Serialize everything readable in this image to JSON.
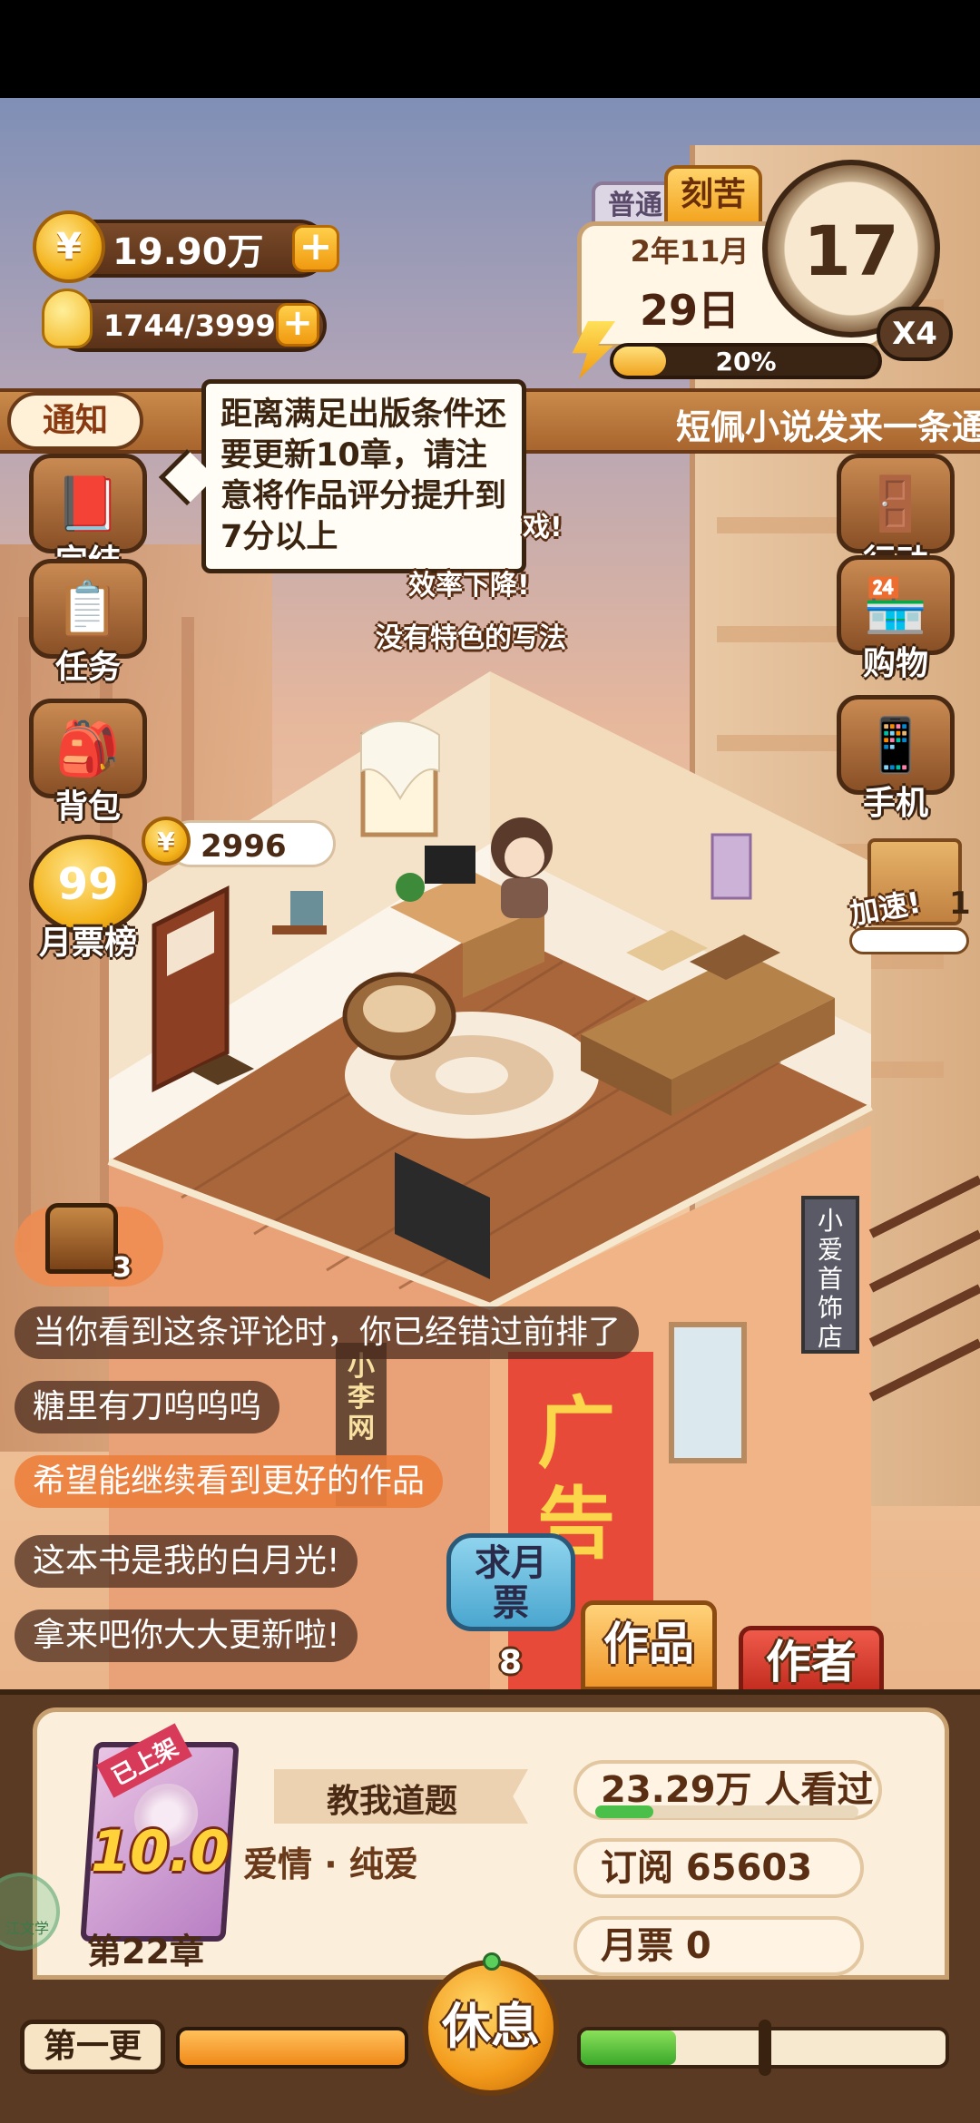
{
  "resources": {
    "coins": "19.90万",
    "energy": "1744/3999",
    "coin_icon": "coin-icon",
    "energy_icon": "lightbulb-icon"
  },
  "calendar": {
    "mode_tab_normal": "普通",
    "mode_tab_hard": "刻苦",
    "month": "2年11月",
    "day": "29日",
    "hour": "17",
    "speed": "X4",
    "progress_label": "20%",
    "progress": 0.2
  },
  "notice": {
    "label": "通知",
    "ticker": "短佩小说发来一条通"
  },
  "tooltip": {
    "text": "距离满足出版条件还要更新10章，请注意将作品评分提升到7分以上"
  },
  "floating_texts": [
    "戏!",
    "效率下降!",
    "没有特色的写法"
  ],
  "left_menu": [
    {
      "label": "完结",
      "icon": "book-icon"
    },
    {
      "label": "任务",
      "icon": "checklist-icon"
    },
    {
      "label": "背包",
      "icon": "backpack-icon"
    },
    {
      "label": "月票榜",
      "icon": "trophy-99-icon"
    }
  ],
  "right_menu": [
    {
      "label": "行动",
      "icon": "door-icon"
    },
    {
      "label": "购物",
      "icon": "shop-icon"
    },
    {
      "label": "手机",
      "icon": "phone-icon"
    }
  ],
  "room": {
    "reward_bubble": "2996",
    "speedup_label": "加速!",
    "speedup_count": "1",
    "shop_sign": "小爱首饰店",
    "net_sign": "小李网",
    "ad_sign": "广告"
  },
  "chest": {
    "count": "3"
  },
  "comments": [
    {
      "text": "当你看到这条评论时，你已经错过前排了",
      "highlight": false
    },
    {
      "text": "糖里有刀呜呜呜",
      "highlight": false
    },
    {
      "text": "希望能继续看到更好的作品",
      "highlight": true
    },
    {
      "text": "这本书是我的白月光!",
      "highlight": false
    },
    {
      "text": "拿来吧你大大更新啦!",
      "highlight": false
    }
  ],
  "actions": {
    "monthly_ticket_btn": "求月票",
    "monthly_ticket_count": "8",
    "works_tab": "作品",
    "author_tab": "作者"
  },
  "book": {
    "badge": "已上架",
    "score": "10.0",
    "title": "教我道题",
    "genre": "爱情 · 纯爱",
    "chapter": "第22章",
    "views": "23.29万 人看过",
    "views_progress": 0.22,
    "subscriptions": "订阅 65603",
    "monthly_tickets": "月票 0",
    "watermark": "江文学"
  },
  "bottom": {
    "update_label": "第一更",
    "rest_button": "休息",
    "update_progress": 1.0,
    "energy_progress": 0.26
  }
}
